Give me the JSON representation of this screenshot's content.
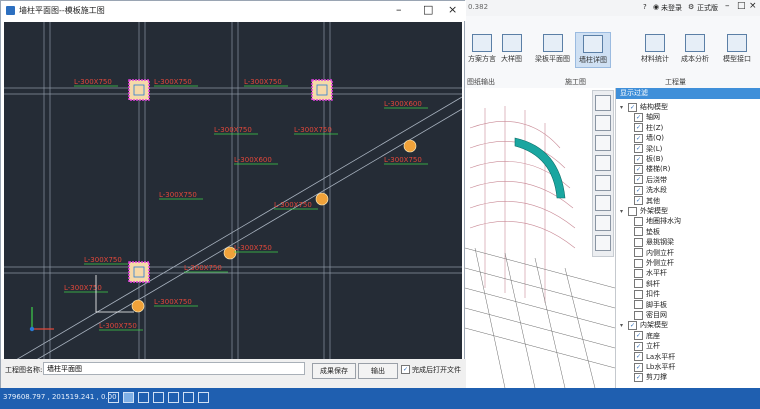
{
  "main_window": {
    "title_version": "0.382",
    "title_right": {
      "login": "未登录",
      "edition": "正式版"
    }
  },
  "ribbon": {
    "buttons": [
      {
        "label": "方案方言"
      },
      {
        "label": "大样图"
      },
      {
        "label": "梁板平面图"
      },
      {
        "label": "墙柱详图"
      },
      {
        "label": "材料统计"
      },
      {
        "label": "成本分析"
      },
      {
        "label": "模型接口"
      }
    ],
    "groups": [
      "施工图",
      "工程量"
    ],
    "left_fragment": "图纸输出"
  },
  "tree_panel": {
    "header": "显示过滤",
    "items": [
      {
        "label": "结构模型",
        "level": 0,
        "checked": true,
        "expanded": true
      },
      {
        "label": "轴网",
        "level": 1,
        "checked": true
      },
      {
        "label": "柱(Z)",
        "level": 1,
        "checked": true
      },
      {
        "label": "墙(Q)",
        "level": 1,
        "checked": true
      },
      {
        "label": "梁(L)",
        "level": 1,
        "checked": true
      },
      {
        "label": "板(B)",
        "level": 1,
        "checked": true
      },
      {
        "label": "楼梯(R)",
        "level": 1,
        "checked": true
      },
      {
        "label": "后浇带",
        "level": 1,
        "checked": true
      },
      {
        "label": "洗水段",
        "level": 1,
        "checked": true
      },
      {
        "label": "其他",
        "level": 1,
        "checked": true
      },
      {
        "label": "外架模型",
        "level": 0,
        "checked": false,
        "expanded": true
      },
      {
        "label": "地圈排水沟",
        "level": 1,
        "checked": false
      },
      {
        "label": "垫板",
        "level": 1,
        "checked": false
      },
      {
        "label": "悬挑钢梁",
        "level": 1,
        "checked": false
      },
      {
        "label": "内侧立杆",
        "level": 1,
        "checked": false
      },
      {
        "label": "外侧立杆",
        "level": 1,
        "checked": false
      },
      {
        "label": "水平杆",
        "level": 1,
        "checked": false
      },
      {
        "label": "斜杆",
        "level": 1,
        "checked": false
      },
      {
        "label": "扣件",
        "level": 1,
        "checked": false
      },
      {
        "label": "脚手板",
        "level": 1,
        "checked": false
      },
      {
        "label": "密目网",
        "level": 1,
        "checked": false
      },
      {
        "label": "内架模型",
        "level": 0,
        "checked": true,
        "expanded": true
      },
      {
        "label": "底座",
        "level": 1,
        "checked": true
      },
      {
        "label": "立杆",
        "level": 1,
        "checked": true
      },
      {
        "label": "La水平杆",
        "level": 1,
        "checked": true
      },
      {
        "label": "Lb水平杆",
        "level": 1,
        "checked": true
      },
      {
        "label": "剪刀撑",
        "level": 1,
        "checked": true
      }
    ]
  },
  "dialog": {
    "title": "墙柱平面图--模板施工图",
    "project_label": "工程图名称:",
    "project_value": "墙柱平面图",
    "save_button": "成果保存",
    "output_button": "输出",
    "open_after_label": "完成后打开文件",
    "open_after_checked": true
  },
  "cad": {
    "beam_labels": [
      "L-300X750",
      "L-300X750",
      "L-300X750",
      "L-300X600",
      "L-300X750",
      "L-300X750",
      "L-300X600",
      "L-300X750",
      "L-300X750",
      "L-300X750",
      "L-300X750",
      "L-300X750",
      "L-300X750",
      "L-300X750",
      "L-300X750",
      "L-300X750"
    ]
  },
  "status": {
    "coordinates": "379608.797 , 201519.241 , 0.00"
  },
  "colors": {
    "cad_bg": "#252c36",
    "accent_blue": "#1f5fb0",
    "column_magenta": "#e23fe0",
    "node_orange": "#f0a23a",
    "label_red": "#e0473a",
    "label_green": "#3fcf4a"
  }
}
